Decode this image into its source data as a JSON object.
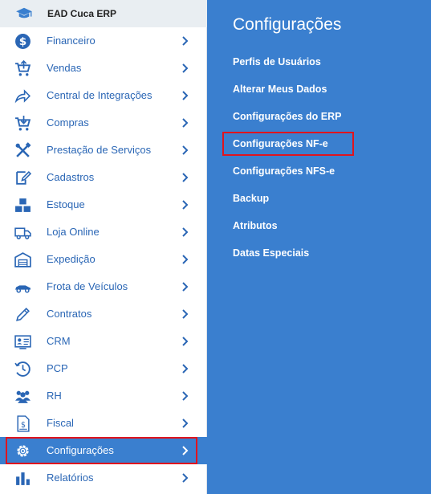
{
  "app": {
    "name": "EAD Cuca ERP"
  },
  "sidebar": {
    "items": [
      {
        "label": "Financeiro",
        "icon": "dollar-icon"
      },
      {
        "label": "Vendas",
        "icon": "cart-icon"
      },
      {
        "label": "Central de Integrações",
        "icon": "share-icon"
      },
      {
        "label": "Compras",
        "icon": "cart-icon"
      },
      {
        "label": "Prestação de Serviços",
        "icon": "tools-icon"
      },
      {
        "label": "Cadastros",
        "icon": "edit-icon"
      },
      {
        "label": "Estoque",
        "icon": "boxes-icon"
      },
      {
        "label": "Loja Online",
        "icon": "truck-icon"
      },
      {
        "label": "Expedição",
        "icon": "warehouse-icon"
      },
      {
        "label": "Frota de Veículos",
        "icon": "car-icon"
      },
      {
        "label": "Contratos",
        "icon": "pencil-icon"
      },
      {
        "label": "CRM",
        "icon": "crm-icon"
      },
      {
        "label": "PCP",
        "icon": "clock-icon"
      },
      {
        "label": "RH",
        "icon": "users-icon"
      },
      {
        "label": "Fiscal",
        "icon": "document-icon"
      },
      {
        "label": "Configurações",
        "icon": "gear-icon",
        "active": true
      },
      {
        "label": "Relatórios",
        "icon": "bar-chart-icon"
      }
    ]
  },
  "panel": {
    "title": "Configurações",
    "links": [
      "Perfis de Usuários",
      "Alterar Meus Dados",
      "Configurações do ERP",
      "Configurações NF-e",
      "Configurações NFS-e",
      "Backup",
      "Atributos",
      "Datas Especiais"
    ]
  },
  "colors": {
    "accent": "#3a7fcf",
    "link_text": "#2a66b5",
    "highlight": "#e0141e",
    "header_bg": "#e9eef2"
  }
}
